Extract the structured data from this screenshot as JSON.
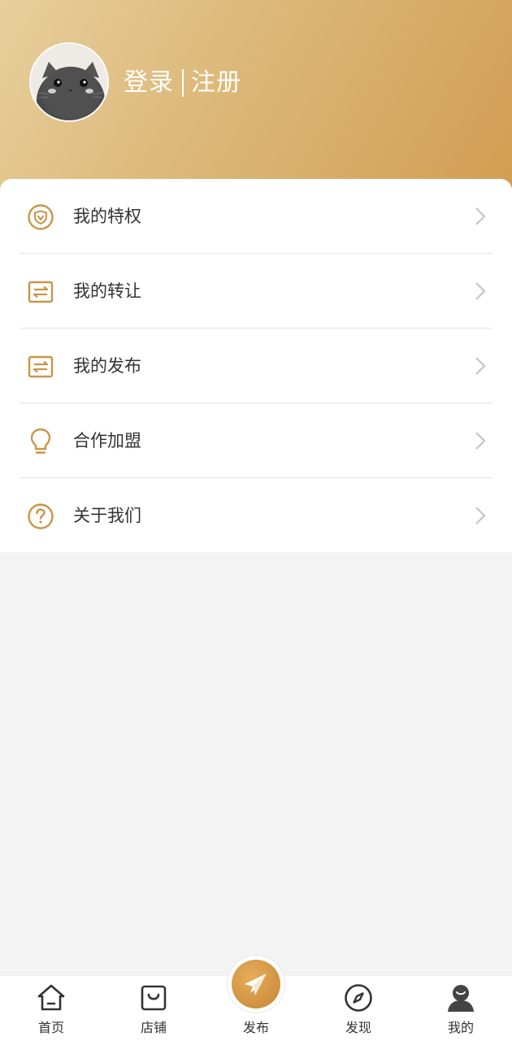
{
  "profile": {
    "login_label": "登录",
    "register_label": "注册"
  },
  "menu": {
    "items": [
      {
        "label": "我的特权",
        "icon": "vip-shield-icon"
      },
      {
        "label": "我的转让",
        "icon": "transfer-icon"
      },
      {
        "label": "我的发布",
        "icon": "transfer-icon"
      },
      {
        "label": "合作加盟",
        "icon": "lightbulb-icon"
      },
      {
        "label": "关于我们",
        "icon": "question-circle-icon"
      }
    ]
  },
  "tabbar": {
    "tabs": [
      {
        "label": "首页",
        "icon": "home-icon"
      },
      {
        "label": "店铺",
        "icon": "shopping-bag-icon"
      },
      {
        "label": "发布",
        "icon": "paper-plane-icon"
      },
      {
        "label": "发现",
        "icon": "compass-icon"
      },
      {
        "label": "我的",
        "icon": "user-icon"
      }
    ],
    "active_index": 4
  },
  "colors": {
    "accent": "#c9954a",
    "header_gradient_start": "#e7cf9c",
    "header_gradient_end": "#d29d52",
    "background": "#f3f3f3",
    "chevron": "#c4c4c4"
  }
}
